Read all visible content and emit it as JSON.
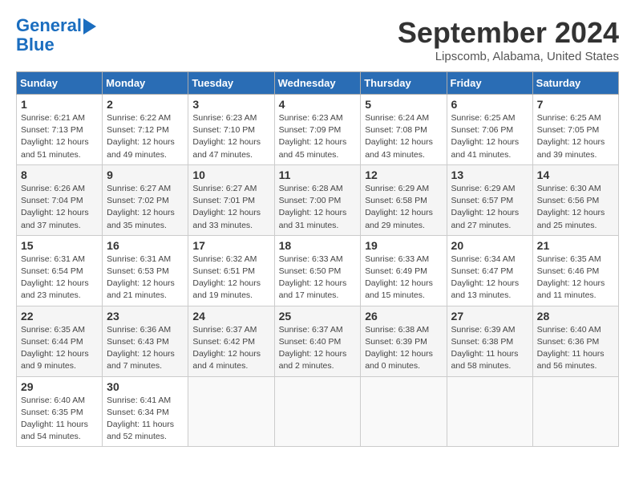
{
  "header": {
    "logo_general": "General",
    "logo_blue": "Blue",
    "month_title": "September 2024",
    "location": "Lipscomb, Alabama, United States"
  },
  "days_of_week": [
    "Sunday",
    "Monday",
    "Tuesday",
    "Wednesday",
    "Thursday",
    "Friday",
    "Saturday"
  ],
  "weeks": [
    [
      {
        "day": "1",
        "sunrise": "6:21 AM",
        "sunset": "7:13 PM",
        "daylight": "12 hours and 51 minutes."
      },
      {
        "day": "2",
        "sunrise": "6:22 AM",
        "sunset": "7:12 PM",
        "daylight": "12 hours and 49 minutes."
      },
      {
        "day": "3",
        "sunrise": "6:23 AM",
        "sunset": "7:10 PM",
        "daylight": "12 hours and 47 minutes."
      },
      {
        "day": "4",
        "sunrise": "6:23 AM",
        "sunset": "7:09 PM",
        "daylight": "12 hours and 45 minutes."
      },
      {
        "day": "5",
        "sunrise": "6:24 AM",
        "sunset": "7:08 PM",
        "daylight": "12 hours and 43 minutes."
      },
      {
        "day": "6",
        "sunrise": "6:25 AM",
        "sunset": "7:06 PM",
        "daylight": "12 hours and 41 minutes."
      },
      {
        "day": "7",
        "sunrise": "6:25 AM",
        "sunset": "7:05 PM",
        "daylight": "12 hours and 39 minutes."
      }
    ],
    [
      {
        "day": "8",
        "sunrise": "6:26 AM",
        "sunset": "7:04 PM",
        "daylight": "12 hours and 37 minutes."
      },
      {
        "day": "9",
        "sunrise": "6:27 AM",
        "sunset": "7:02 PM",
        "daylight": "12 hours and 35 minutes."
      },
      {
        "day": "10",
        "sunrise": "6:27 AM",
        "sunset": "7:01 PM",
        "daylight": "12 hours and 33 minutes."
      },
      {
        "day": "11",
        "sunrise": "6:28 AM",
        "sunset": "7:00 PM",
        "daylight": "12 hours and 31 minutes."
      },
      {
        "day": "12",
        "sunrise": "6:29 AM",
        "sunset": "6:58 PM",
        "daylight": "12 hours and 29 minutes."
      },
      {
        "day": "13",
        "sunrise": "6:29 AM",
        "sunset": "6:57 PM",
        "daylight": "12 hours and 27 minutes."
      },
      {
        "day": "14",
        "sunrise": "6:30 AM",
        "sunset": "6:56 PM",
        "daylight": "12 hours and 25 minutes."
      }
    ],
    [
      {
        "day": "15",
        "sunrise": "6:31 AM",
        "sunset": "6:54 PM",
        "daylight": "12 hours and 23 minutes."
      },
      {
        "day": "16",
        "sunrise": "6:31 AM",
        "sunset": "6:53 PM",
        "daylight": "12 hours and 21 minutes."
      },
      {
        "day": "17",
        "sunrise": "6:32 AM",
        "sunset": "6:51 PM",
        "daylight": "12 hours and 19 minutes."
      },
      {
        "day": "18",
        "sunrise": "6:33 AM",
        "sunset": "6:50 PM",
        "daylight": "12 hours and 17 minutes."
      },
      {
        "day": "19",
        "sunrise": "6:33 AM",
        "sunset": "6:49 PM",
        "daylight": "12 hours and 15 minutes."
      },
      {
        "day": "20",
        "sunrise": "6:34 AM",
        "sunset": "6:47 PM",
        "daylight": "12 hours and 13 minutes."
      },
      {
        "day": "21",
        "sunrise": "6:35 AM",
        "sunset": "6:46 PM",
        "daylight": "12 hours and 11 minutes."
      }
    ],
    [
      {
        "day": "22",
        "sunrise": "6:35 AM",
        "sunset": "6:44 PM",
        "daylight": "12 hours and 9 minutes."
      },
      {
        "day": "23",
        "sunrise": "6:36 AM",
        "sunset": "6:43 PM",
        "daylight": "12 hours and 7 minutes."
      },
      {
        "day": "24",
        "sunrise": "6:37 AM",
        "sunset": "6:42 PM",
        "daylight": "12 hours and 4 minutes."
      },
      {
        "day": "25",
        "sunrise": "6:37 AM",
        "sunset": "6:40 PM",
        "daylight": "12 hours and 2 minutes."
      },
      {
        "day": "26",
        "sunrise": "6:38 AM",
        "sunset": "6:39 PM",
        "daylight": "12 hours and 0 minutes."
      },
      {
        "day": "27",
        "sunrise": "6:39 AM",
        "sunset": "6:38 PM",
        "daylight": "11 hours and 58 minutes."
      },
      {
        "day": "28",
        "sunrise": "6:40 AM",
        "sunset": "6:36 PM",
        "daylight": "11 hours and 56 minutes."
      }
    ],
    [
      {
        "day": "29",
        "sunrise": "6:40 AM",
        "sunset": "6:35 PM",
        "daylight": "11 hours and 54 minutes."
      },
      {
        "day": "30",
        "sunrise": "6:41 AM",
        "sunset": "6:34 PM",
        "daylight": "11 hours and 52 minutes."
      },
      null,
      null,
      null,
      null,
      null
    ]
  ]
}
